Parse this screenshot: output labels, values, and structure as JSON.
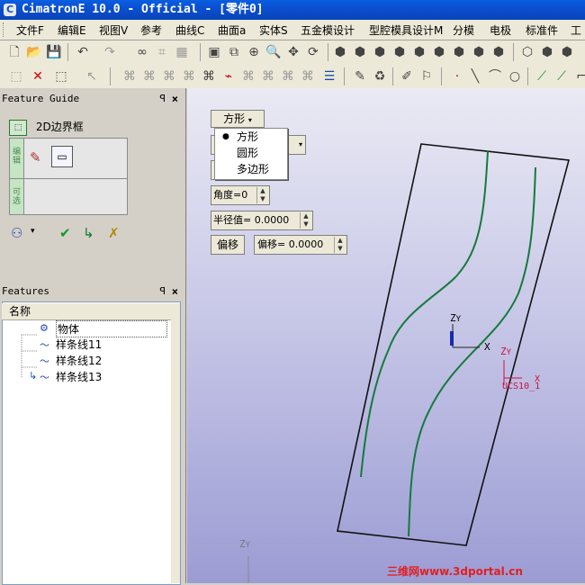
{
  "window": {
    "title": "CimatronE 10.0 - Official - [零件0]",
    "app_icon_glyph": "C"
  },
  "menu": [
    "文件F",
    "编辑E",
    "视图V",
    "参考",
    "曲线C",
    "曲面a",
    "实体S",
    "五金模设计",
    "型腔模具设计M",
    "分模",
    "电极",
    "标准件",
    "工"
  ],
  "feature_guide": {
    "header": "Feature Guide",
    "pin": "ꟼ",
    "close": "×",
    "title": "2D边界框",
    "side_labels": [
      "编辑",
      "可选"
    ],
    "actions": [
      "apply-icon",
      "check-icon",
      "next-icon",
      "cancel-icon"
    ]
  },
  "features": {
    "header": "Features",
    "pin": "ꟼ",
    "close": "×",
    "column": "名称",
    "items": [
      "物体",
      "样条线11",
      "样条线12",
      "样条线13"
    ]
  },
  "viewport": {
    "shape_dropdown": "方形",
    "shape_options": [
      "方形",
      "圆形",
      "多边形"
    ],
    "angle_label": "角度=0",
    "radius_label": "半径值=",
    "radius_value": "0.0000",
    "offset_button": "偏移",
    "offset_label": "偏移=",
    "offset_value": "0.0000",
    "axis_z": "Z",
    "axis_y": "Y",
    "axis_x": "X",
    "ucs_label": "UCS10_1"
  },
  "watermark": "三维网www.3dportal.cn",
  "colors": {
    "title_bar": "#0b4fd2",
    "viewport_top": "#eaeaf4",
    "viewport_bottom": "#9c9cd4",
    "curve": "#157a3a",
    "ucs": "#d0103a"
  }
}
